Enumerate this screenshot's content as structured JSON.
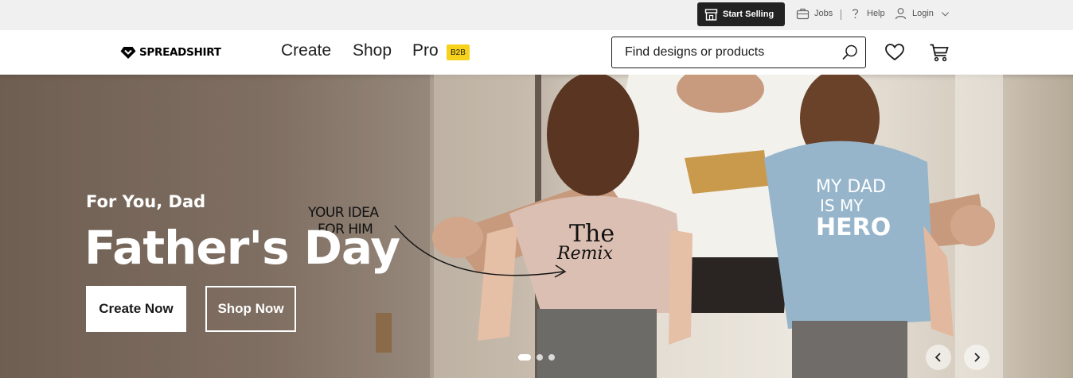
{
  "utility_bar": {
    "start_selling_label": "Start Selling",
    "jobs_label": "Jobs",
    "help_label": "Help",
    "login_label": "Login"
  },
  "header": {
    "logo_text": "SPREADSHIRT",
    "nav": [
      {
        "label": "Create"
      },
      {
        "label": "Shop"
      },
      {
        "label": "Pro"
      }
    ],
    "pro_badge": "B2B",
    "search_placeholder": "Find designs or products"
  },
  "hero": {
    "kicker": "For You, Dad",
    "title": "Father's Day",
    "primary_cta": "Create Now",
    "secondary_cta": "Shop Now",
    "annotation_line1": "YOUR IDEA",
    "annotation_line2": "FOR HIM",
    "slide_count": 3,
    "active_slide": 1
  },
  "colors": {
    "utility_bg": "#f0f0f0",
    "start_selling_bg": "#222222",
    "b2b_badge": "#f7d21c"
  }
}
